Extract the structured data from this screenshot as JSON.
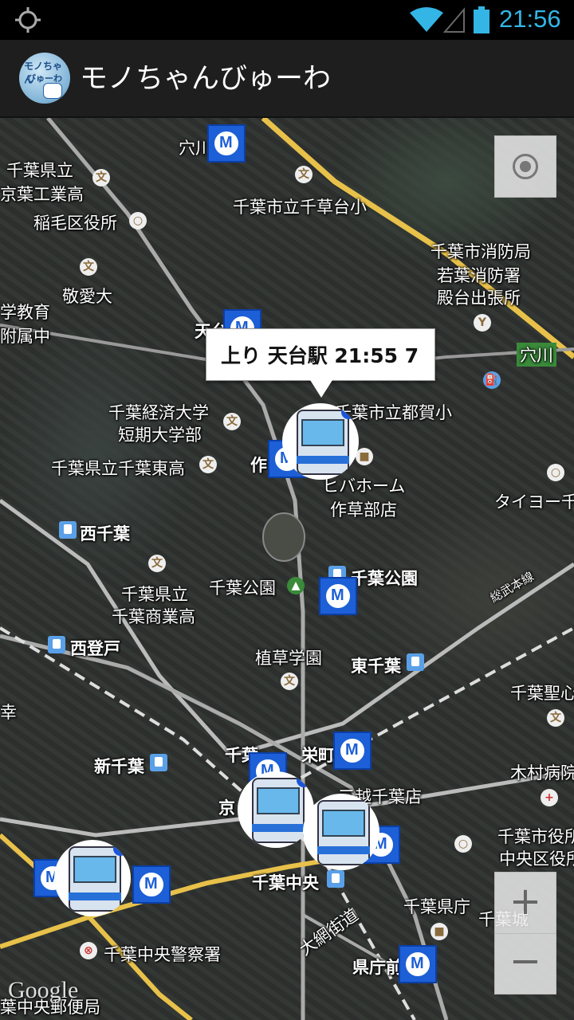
{
  "status_bar": {
    "time": "21:56",
    "icons": [
      "gps-icon",
      "wifi-icon",
      "signal-icon",
      "battery-icon"
    ],
    "accent": "#33b5e5"
  },
  "app": {
    "title": "モノちゃんびゅーわ",
    "icon_text_1": "モノちゃん",
    "icon_text_2": "びゅーわ"
  },
  "callout": {
    "text": "上り 天台駅 21:55 7"
  },
  "map": {
    "labels": {
      "anagawa_top": "穴川",
      "chiba_kenritsu": "千葉県立",
      "keiyo_kogyo": "京葉工業高",
      "chikusa_sho": "千葉市立千草台小",
      "inage_ward": "稲毛区役所",
      "fire_dept": "千葉市消防局",
      "wakamatsu_fire": "若葉消防署",
      "tonodai": "殿台出張所",
      "keiai": "敬愛大",
      "gakukyo": "学教育",
      "fuzoku": "附属中",
      "tendai": "天台",
      "anagawa_right": "穴川",
      "keizai1": "千葉経済大学",
      "keizai2": "短期大学部",
      "tsuga_sho": "千葉市立都賀小",
      "chiba_higashi": "千葉県立千葉東高",
      "sakusa": "作",
      "hibahome1": "ヒバホーム",
      "hibahome2": "作草部店",
      "taiyo": "タイヨー千",
      "nishichiba": "西千葉",
      "chiba_park_station": "千葉公園",
      "chiba_park": "千葉公園",
      "sobu": "総武本線",
      "chiba_kenritsu2": "千葉県立",
      "shogyo": "千葉商業高",
      "nishinobuto": "西登戸",
      "shokusou": "植草学園",
      "higashichiba": "東千葉",
      "chiba_seishin": "千葉聖心",
      "ko": "幸",
      "shinchiba": "新千葉",
      "chiba_st": "千葉",
      "sakae": "栄町",
      "kimura": "木村病院",
      "mitsukoshi": "三越千葉店",
      "kyo": "京",
      "chuo_ward1": "千葉市役所",
      "chuo_ward2": "中央区役所案",
      "chiba_chuo": "千葉中央",
      "kencho": "千葉県庁",
      "chiba_castle": "千葉城",
      "police": "千葉中央警察署",
      "omi_kaido": "大網街道",
      "kenchomae": "県庁前",
      "post": "葉中央郵便局"
    }
  },
  "controls": {
    "zoom_in": "+",
    "zoom_out": "−"
  },
  "attribution": "Google"
}
